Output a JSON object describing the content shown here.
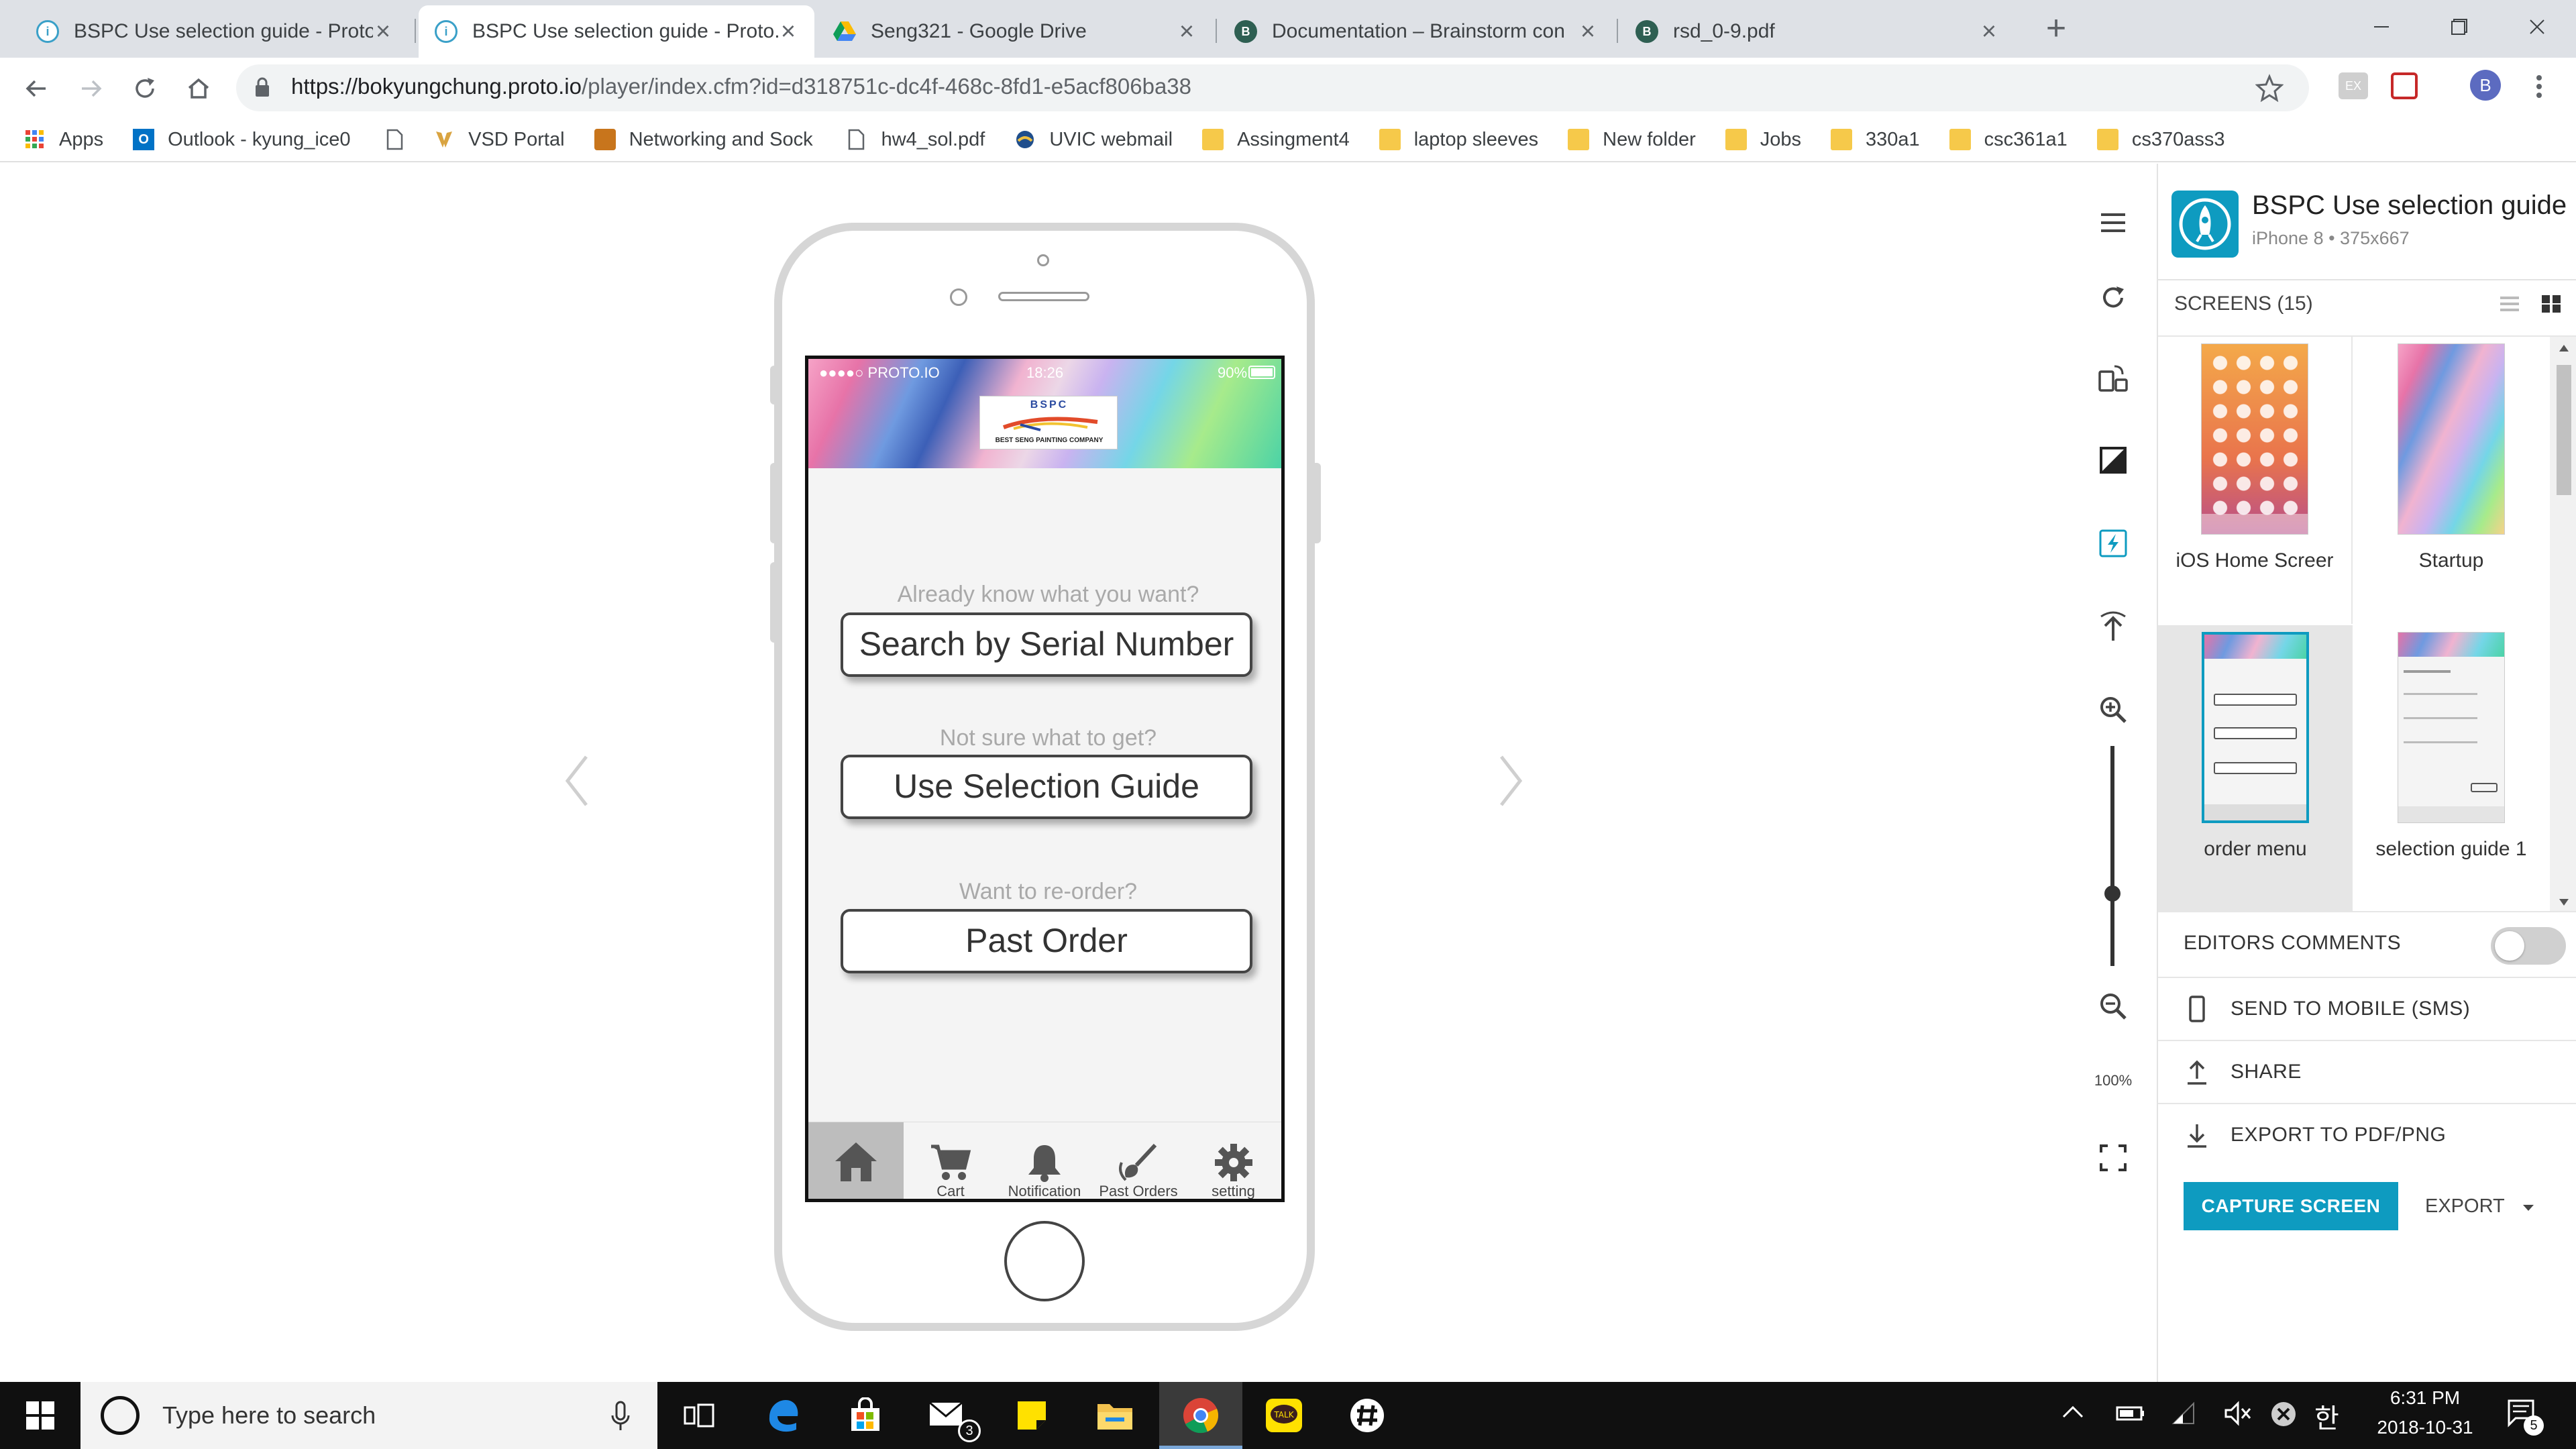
{
  "browser": {
    "tabs": [
      {
        "title": "BSPC Use selection guide - Proto.io",
        "favicon": "protoio-icon",
        "active": false
      },
      {
        "title": "BSPC Use selection guide - Proto.io",
        "favicon": "protoio-icon",
        "active": true
      },
      {
        "title": "Seng321 - Google Drive",
        "favicon": "google-drive-icon",
        "active": false
      },
      {
        "title": "Documentation – Brainstorm con",
        "favicon": "bs-icon",
        "active": false
      },
      {
        "title": "rsd_0-9.pdf",
        "favicon": "bs-icon",
        "active": false
      }
    ],
    "url_host": "https://bokyungchung.proto.io",
    "url_path": "/player/index.cfm?id=d318751c-dc4f-468c-8fd1-e5acf806ba38",
    "profile_initial": "B",
    "extension_label": "EX",
    "bookmarks": [
      {
        "label": "Apps",
        "icon": "apps-grid-icon"
      },
      {
        "label": "Outlook - kyung_ice0",
        "icon": "outlook-icon"
      },
      {
        "label": "",
        "icon": "page-icon"
      },
      {
        "label": "VSD Portal",
        "icon": "vsd-icon"
      },
      {
        "label": "Networking and Sock",
        "icon": "networking-icon"
      },
      {
        "label": "hw4_sol.pdf",
        "icon": "page-icon"
      },
      {
        "label": "UVIC webmail",
        "icon": "uvic-icon"
      },
      {
        "label": "Assingment4",
        "icon": "folder-icon"
      },
      {
        "label": "laptop sleeves",
        "icon": "folder-icon"
      },
      {
        "label": "New folder",
        "icon": "folder-icon"
      },
      {
        "label": "Jobs",
        "icon": "folder-icon"
      },
      {
        "label": "330a1",
        "icon": "folder-icon"
      },
      {
        "label": "csc361a1",
        "icon": "folder-icon"
      },
      {
        "label": "cs370ass3",
        "icon": "folder-icon"
      }
    ]
  },
  "phone": {
    "status_carrier": "●●●●○ PROTO.IO",
    "status_time": "18:26",
    "status_battery": "90%",
    "logo_text": "BSPC",
    "logo_subtext": "BEST SENG PAINTING COMPANY",
    "q1": "Already know what you want?",
    "btn1": "Search by Serial Number",
    "q2": "Not sure what to get?",
    "btn2": "Use Selection Guide",
    "q3": "Want to re-order?",
    "btn3": "Past Order",
    "tabs": [
      "",
      "Cart",
      "Notification",
      "Past Orders",
      "setting"
    ]
  },
  "tools": {
    "zoom_label": "100%"
  },
  "panel": {
    "project_title": "BSPC Use selection guide",
    "device": "iPhone 8 • 375x667",
    "screens_header": "SCREENS (15)",
    "screens": [
      {
        "label": "iOS Home Screer"
      },
      {
        "label": "Startup"
      },
      {
        "label": "order menu"
      },
      {
        "label": "selection guide 1"
      }
    ],
    "editors_comments": "EDITORS COMMENTS",
    "send_to_mobile": "SEND TO MOBILE (SMS)",
    "share": "SHARE",
    "export_pdf": "EXPORT TO PDF/PNG",
    "capture_button": "CAPTURE SCREEN",
    "export_button": "EXPORT",
    "accent": "#0e9bc0"
  },
  "taskbar": {
    "search_placeholder": "Type here to search",
    "mail_badge": "3",
    "time": "6:31 PM",
    "date": "2018-10-31",
    "notification_count": "5",
    "ime_label": "한"
  }
}
